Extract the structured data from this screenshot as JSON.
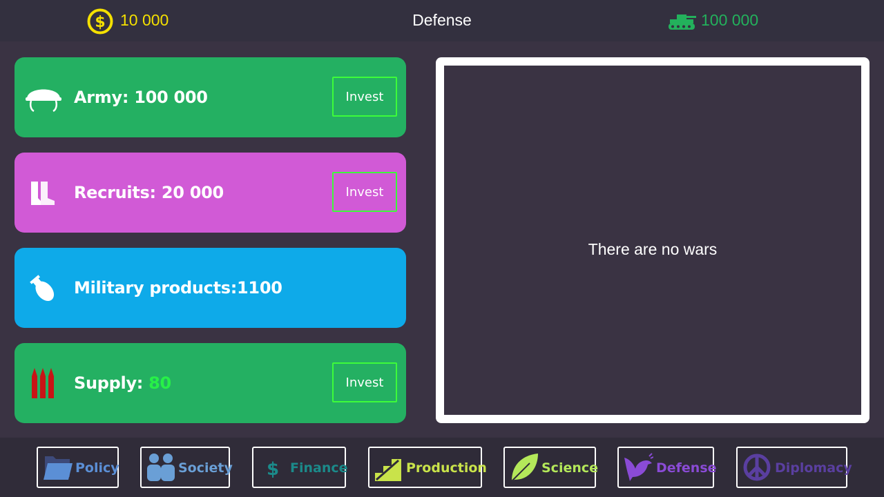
{
  "header": {
    "coins": "10 000",
    "title": "Defense",
    "military_strength": "100 000",
    "coin_color": "#f4e000",
    "strength_color": "#23b15c"
  },
  "cards": {
    "army": {
      "label": "Army: 100 000",
      "button": "Invest",
      "icon": "helmet-icon",
      "color": "#24b062"
    },
    "recruits": {
      "label": "Recruits: 20 000",
      "button": "Invest",
      "icon": "boots-icon",
      "color": "#d15ad6"
    },
    "military_products": {
      "label": "Military products:1100",
      "icon": "bomb-icon",
      "color": "#0eaae9"
    },
    "supply": {
      "label": "Supply: ",
      "value": "80",
      "button": "Invest",
      "icon": "ammo-icon",
      "color": "#24b062"
    }
  },
  "wars": {
    "message": "There are no wars"
  },
  "nav": {
    "policy": {
      "label": "Policy",
      "icon": "folder-icon",
      "color": "#5b8fd6"
    },
    "society": {
      "label": "Society",
      "icon": "people-icon",
      "color": "#6a9fd6"
    },
    "finance": {
      "label": "Finance",
      "icon": "dollar-icon",
      "color": "#1b8a8a"
    },
    "production": {
      "label": "Production",
      "icon": "factory-icon",
      "color": "#c9e34a"
    },
    "science": {
      "label": "Science",
      "icon": "leaf-icon",
      "color": "#b4e85a"
    },
    "defense": {
      "label": "Defense",
      "icon": "dove-icon",
      "color": "#8a4bd6"
    },
    "diplomacy": {
      "label": "Diplomacy",
      "icon": "peace-icon",
      "color": "#5a3fa0"
    }
  }
}
